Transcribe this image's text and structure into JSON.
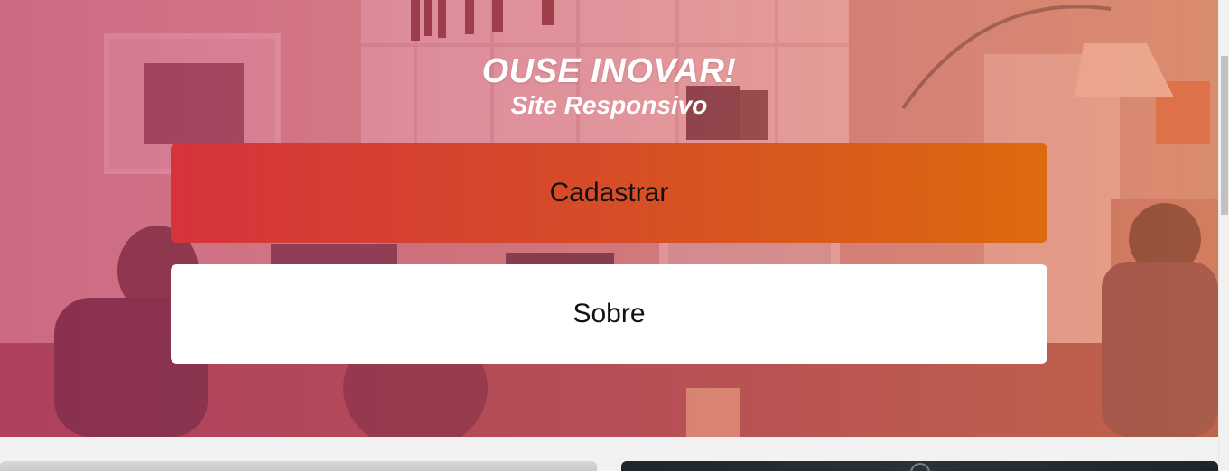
{
  "hero": {
    "title": "OUSE INOVAR!",
    "subtitle": "Site Responsivo",
    "background_image": "office-photo",
    "overlay_colors": [
      "#c43a68",
      "#e87848"
    ]
  },
  "buttons": {
    "primary_label": "Cadastrar",
    "secondary_label": "Sobre",
    "primary_gradient": [
      "#d5343b",
      "#dc6a0e"
    ],
    "secondary_color": "#ffffff"
  },
  "cards": {
    "left_image": "light-gray-photo",
    "right_image": "dark-photo"
  }
}
